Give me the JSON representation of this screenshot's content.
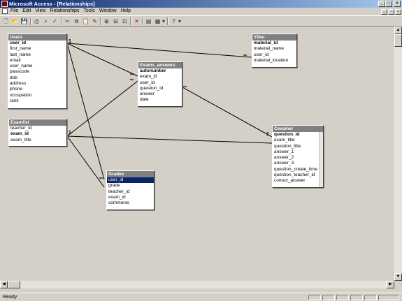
{
  "window": {
    "title": "Microsoft Access - [Relationships]"
  },
  "menu": [
    "File",
    "Edit",
    "View",
    "Relationships",
    "Tools",
    "Window",
    "Help"
  ],
  "status": {
    "text": "Ready"
  },
  "tables": {
    "users": {
      "title": "Users",
      "fields": [
        "user_id",
        "first_name",
        "last_name",
        "email",
        "user_name",
        "passcode",
        "dob",
        "address",
        "phone",
        "occupation",
        "rank"
      ]
    },
    "yliko": {
      "title": "Yliko",
      "fields": [
        "material_id",
        "material_name",
        "user_id",
        "material_location"
      ]
    },
    "exams_answers": {
      "title": "Exams_answers",
      "fields": [
        "autonumber",
        "exam_id",
        "user_id",
        "question_id",
        "answer",
        "date"
      ]
    },
    "examlist": {
      "title": "Examlist",
      "fields": [
        "teacher_id",
        "exam_id",
        "exam_title"
      ]
    },
    "cexamer": {
      "title": "Cexamer",
      "fields": [
        "question_id",
        "exam_title",
        "question_title",
        "answer_1",
        "answer_2",
        "answer_3",
        "question_create_time",
        "question_teacher_id",
        "correct_answer"
      ]
    },
    "grades": {
      "title": "Grades",
      "fields": [
        "user_id",
        "grade",
        "teacher_id",
        "exam_id",
        "comments"
      ]
    }
  },
  "markers": {
    "one": "1",
    "many": "∞"
  }
}
